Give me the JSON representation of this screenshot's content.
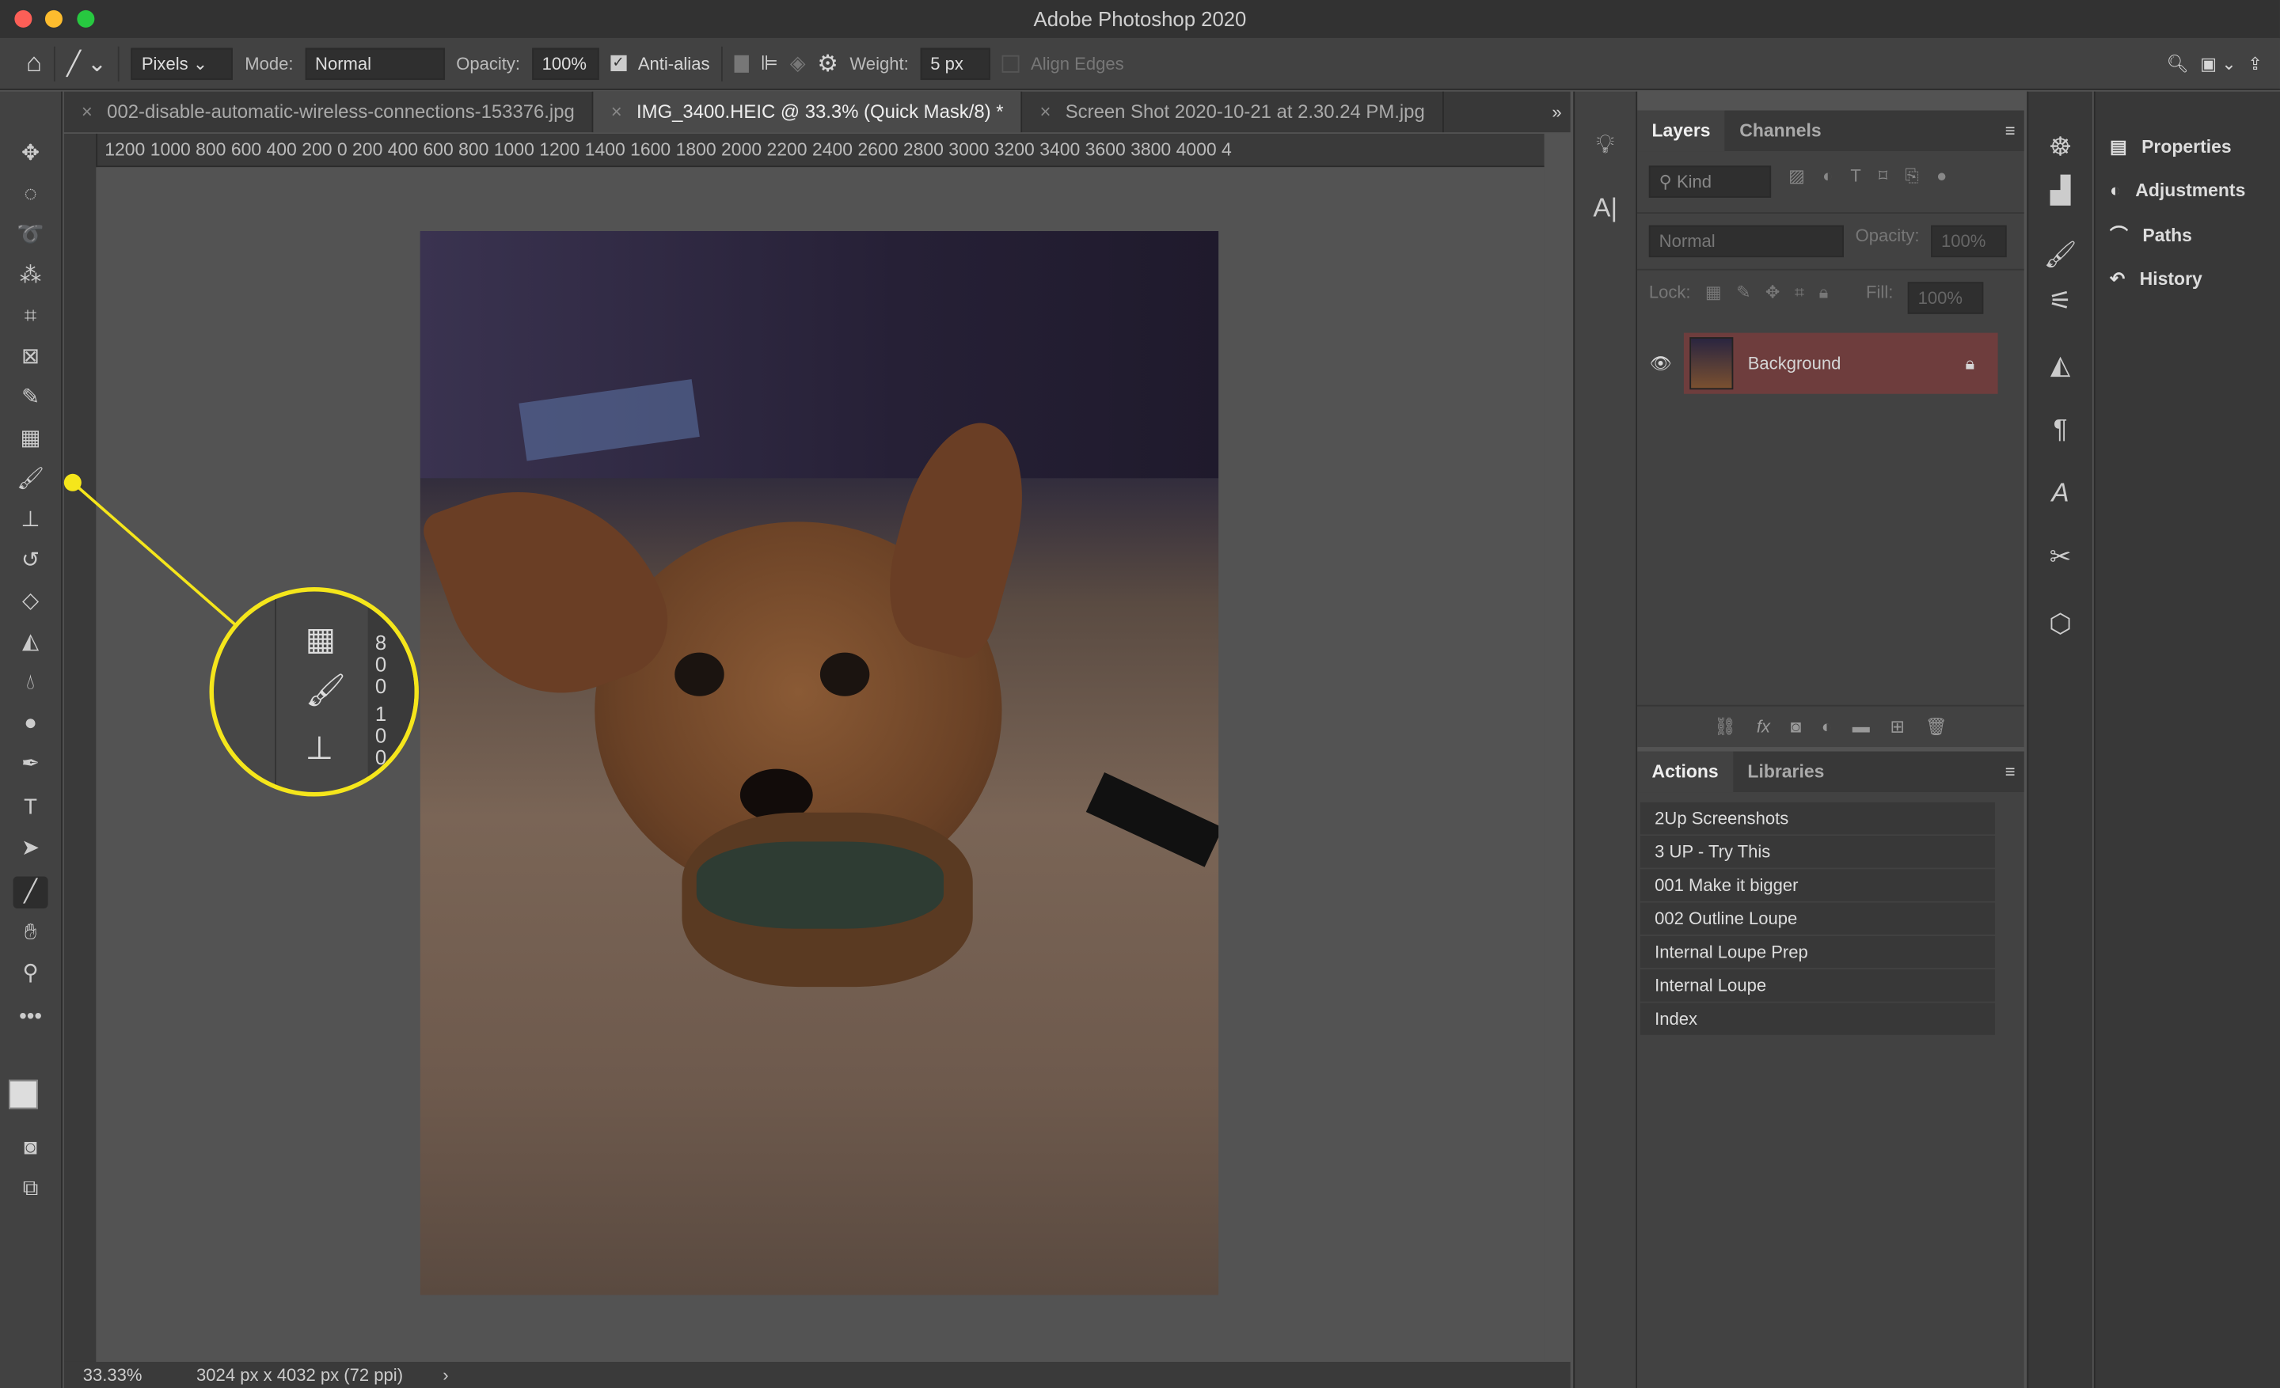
{
  "app": {
    "title": "Adobe Photoshop 2020"
  },
  "options": {
    "fill_mode": "Pixels",
    "mode_label": "Mode:",
    "mode": "Normal",
    "opacity_label": "Opacity:",
    "opacity": "100%",
    "antialias_label": "Anti-alias",
    "antialias": true,
    "weight_label": "Weight:",
    "weight": "5 px",
    "align_edges_label": "Align Edges"
  },
  "tabs": [
    {
      "label": "002-disable-automatic-wireless-connections-153376.jpg",
      "active": false
    },
    {
      "label": "IMG_3400.HEIC @ 33.3% (Quick Mask/8) *",
      "active": true
    },
    {
      "label": "Screen Shot 2020-10-21 at 2.30.24 PM.jpg",
      "active": false
    }
  ],
  "ruler": {
    "h_ticks": "1200  1000   800   600   400   200    0    200   400   600   800  1000  1200  1400  1600  1800  2000  2200  2400  2600  2800  3000  3200  3400  3600  3800  4000  4"
  },
  "status": {
    "zoom": "33.33%",
    "doc_info": "3024 px x 4032 px (72 ppi)"
  },
  "layers_panel": {
    "tabs": [
      "Layers",
      "Channels"
    ],
    "filter": "Kind",
    "blend": "Normal",
    "opacity_label": "Opacity:",
    "opacity": "100%",
    "lock_label": "Lock:",
    "fill_label": "Fill:",
    "fill": "100%",
    "layers": [
      {
        "name": "Background",
        "visible": true,
        "locked": true
      }
    ]
  },
  "actions_panel": {
    "tabs": [
      "Actions",
      "Libraries"
    ],
    "items": [
      "2Up Screenshots",
      "3 UP - Try This",
      "001 Make it bigger",
      "002 Outline Loupe",
      "Internal Loupe Prep",
      "Internal Loupe",
      "Index"
    ]
  },
  "right_panel": {
    "items": [
      "Properties",
      "Adjustments",
      "Paths",
      "History"
    ]
  },
  "loupe": {
    "ruler_digits": [
      "8",
      "0",
      "0",
      "1",
      "0",
      "0"
    ],
    "highlight_color": "#f5e61b"
  },
  "colors": {
    "selected_layer": "#6e3d3d",
    "accent_loupe": "#f5e61b"
  }
}
